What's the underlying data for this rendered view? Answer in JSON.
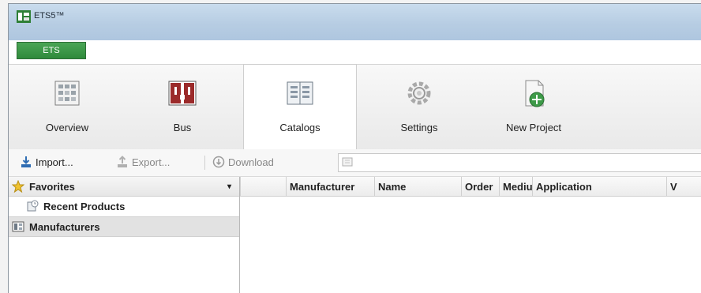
{
  "app": {
    "title": "ETS5™",
    "tab_label": "ETS"
  },
  "ribbon": {
    "items": [
      {
        "label": "Overview",
        "icon": "overview-icon"
      },
      {
        "label": "Bus",
        "icon": "bus-icon"
      },
      {
        "label": "Catalogs",
        "icon": "catalogs-icon"
      },
      {
        "label": "Settings",
        "icon": "settings-icon"
      },
      {
        "label": "New Project",
        "icon": "new-project-icon"
      }
    ],
    "active": "Catalogs"
  },
  "toolbar": {
    "import_label": "Import...",
    "export_label": "Export...",
    "download_label": "Download"
  },
  "tree": {
    "favorites_label": "Favorites",
    "recent_label": "Recent Products",
    "manufacturers_label": "Manufacturers"
  },
  "grid": {
    "columns": [
      "Manufacturer",
      "Name",
      "Order",
      "Mediu",
      "Application",
      "V"
    ]
  },
  "colors": {
    "accent_green": "#2f8a3b",
    "titlebar": "#b7cde3",
    "selection_gray": "#e2e2e2"
  }
}
